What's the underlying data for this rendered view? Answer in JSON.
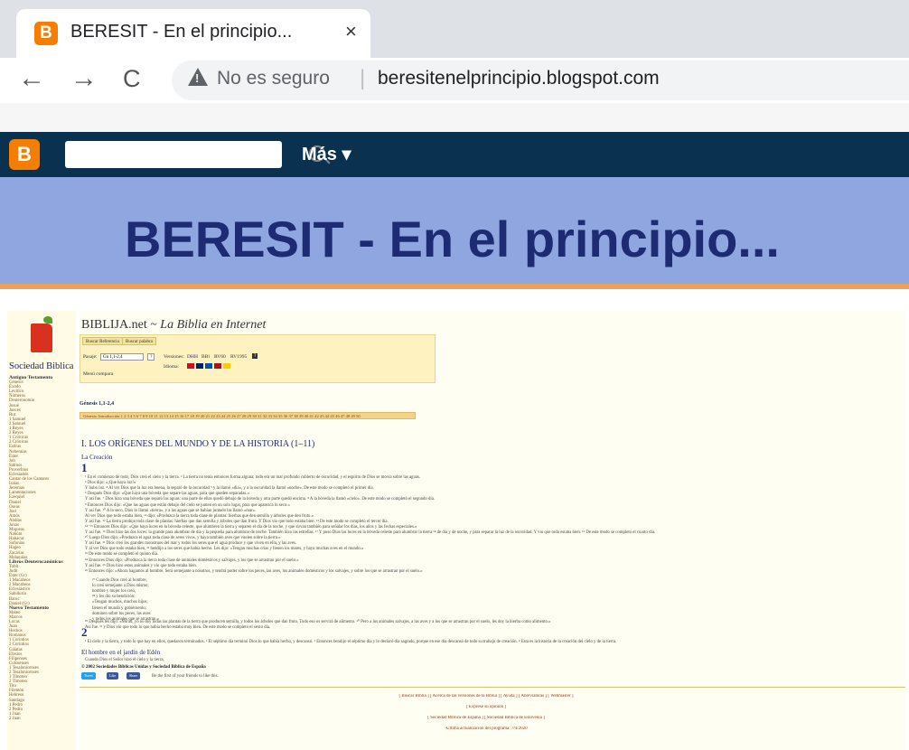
{
  "browser": {
    "tab_title": "BERESIT - En el principio...",
    "tab_close": "×",
    "tab_favicon_letter": "B",
    "nav_back": "←",
    "nav_forward": "→",
    "nav_reload": "C",
    "security_text": "No es seguro",
    "url": "beresitenelprincipio.blogspot.com"
  },
  "blogger_navbar": {
    "logo_letter": "B",
    "more_label": "Más ▾",
    "search_icon": "search-icon"
  },
  "blog": {
    "title": "BERESIT - En el principio..."
  },
  "embedded": {
    "sidebar": {
      "name": "Sociedad Biblica",
      "items": [
        {
          "text": "Antiguo Testamento",
          "heading": true
        },
        {
          "text": "Génesis"
        },
        {
          "text": "Éxodo"
        },
        {
          "text": "Levítico"
        },
        {
          "text": "Números"
        },
        {
          "text": "Deuteronomio"
        },
        {
          "text": "Josué"
        },
        {
          "text": "Jueces"
        },
        {
          "text": "Rut"
        },
        {
          "text": "1 Samuel"
        },
        {
          "text": "2 Samuel"
        },
        {
          "text": "1 Reyes"
        },
        {
          "text": "2 Reyes"
        },
        {
          "text": "1 Crónicas"
        },
        {
          "text": "2 Crónicas"
        },
        {
          "text": "Esdras"
        },
        {
          "text": "Nehemías"
        },
        {
          "text": "Ester"
        },
        {
          "text": "Job"
        },
        {
          "text": "Salmos"
        },
        {
          "text": "Proverbios"
        },
        {
          "text": "Eclesiastés"
        },
        {
          "text": "Cantar de los Cantares"
        },
        {
          "text": "Isaías"
        },
        {
          "text": "Jeremías"
        },
        {
          "text": "Lamentaciones"
        },
        {
          "text": "Ezequiel"
        },
        {
          "text": "Daniel"
        },
        {
          "text": "Oseas"
        },
        {
          "text": "Joel"
        },
        {
          "text": "Amós"
        },
        {
          "text": "Abdías"
        },
        {
          "text": "Jonás"
        },
        {
          "text": "Miqueas"
        },
        {
          "text": "Nahúm"
        },
        {
          "text": "Habacuc"
        },
        {
          "text": "Sofonías"
        },
        {
          "text": "Hageo"
        },
        {
          "text": "Zacarías"
        },
        {
          "text": "Malaquías"
        },
        {
          "text": "Libros Deuterocanónicos",
          "heading": true
        },
        {
          "text": "Tobit"
        },
        {
          "text": "Judit"
        },
        {
          "text": "Ester (Gr)"
        },
        {
          "text": "1 Macabeos"
        },
        {
          "text": "2 Macabeos"
        },
        {
          "text": "Eclesiástico"
        },
        {
          "text": "Sabiduría"
        },
        {
          "text": "Baruc"
        },
        {
          "text": "Daniel (Gr)"
        },
        {
          "text": "Nuevo Testamento",
          "heading": true
        },
        {
          "text": "Mateo"
        },
        {
          "text": "Marcos"
        },
        {
          "text": "Lucas"
        },
        {
          "text": "Juan"
        },
        {
          "text": "Hechos"
        },
        {
          "text": "Romanos"
        },
        {
          "text": "1 Corintios"
        },
        {
          "text": "2 Corintios"
        },
        {
          "text": "Gálatas"
        },
        {
          "text": "Efesios"
        },
        {
          "text": "Filipenses"
        },
        {
          "text": "Colosenses"
        },
        {
          "text": "1 Tesalonicenses"
        },
        {
          "text": "2 Tesalonicenses"
        },
        {
          "text": "1 Timoteo"
        },
        {
          "text": "2 Timoteo"
        },
        {
          "text": "Tito"
        },
        {
          "text": "Filemón"
        },
        {
          "text": "Hebreos"
        },
        {
          "text": "Santiago"
        },
        {
          "text": "1 Pedro"
        },
        {
          "text": "2 Pedro"
        },
        {
          "text": "1 Juan"
        },
        {
          "text": "2 Juan"
        }
      ]
    },
    "main": {
      "site": "BIBLIJA.net",
      "site_sep": "~",
      "site_subtitle": "La Biblia en Internet",
      "tabs": [
        "Buscar Referencia",
        "Buscar palabra"
      ],
      "passage_label": "Pasaje:",
      "passage_value": "Gn 1,1-2,4",
      "go_label": "?",
      "versions_label": "Versiones:",
      "versions": [
        "DHH",
        "BBl",
        "RV60",
        "RV1995",
        "?"
      ],
      "language_label": "Idioma:",
      "compare_label": "Menú compara",
      "reference": "Génesis 1,1-2,4",
      "chapter_bar": "Génesis:  Introducción 1 2 3 4 5 6 7 8 9 10 11 12 13 14 15 16 17 18 19 20 21 22 23 24 25 26 27 28 29 30 31 32 33 34 35 36 37 38 39 40 41 42 43 44 45 46 47 48 49 50",
      "section_title": "I. LOS ORÍGENES DEL MUNDO Y DE LA HISTORIA (1–11)",
      "subtitle": "La Creación",
      "chapter1": "1",
      "verses1": [
        "¹ En el comienzo de todo, Dios creó el cielo y la tierra. ² La tierra no tenía entonces forma alguna; todo era un mar profundo cubierto de oscuridad, y el espíritu de Dios se movía sobre las aguas.",
        "³ Dios dijo: «¡Que haya luz!»",
        "Y hubo luz. ⁴ Al ver Dios que la luz era buena, la separó de la oscuridad ⁵ y la llamó «día», y a la oscuridad la llamó «noche». De este modo se completó el primer día.",
        "⁶ Después Dios dijo: «Que haya una bóveda que separe las aguas, para que queden separadas.»",
        "Y así fue. ⁷ Dios hizo una bóveda que separó las aguas: una parte de ellas quedó debajo de la bóveda y otra parte quedó encima. ⁸ A la bóveda la llamó «cielo». De este modo se completó el segundo día.",
        "⁹ Entonces Dios dijo: «Que las aguas que están debajo del cielo se junten en un solo lugar, para que aparezca lo seco.»",
        "Y así fue. ¹⁰ A lo seco, Dios lo llamó «tierra», y a las aguas que se habían juntado las llamó «mar».",
        "Al ver Dios que todo estaba bien, ¹¹ dijo: «Produzca la tierra toda clase de plantas: hierbas que den semilla y árboles que den fruto.»",
        "Y así fue. ¹² La tierra produjo toda clase de plantas: hierbas que dan semilla y árboles que dan fruto. Y Dios vio que todo estaba bien. ¹³ De este modo se completó el tercer día.",
        "¹⁴⁻¹⁵ Entonces Dios dijo: «Que haya luces en la bóveda celeste, que alumbren la tierra y separen el día de la noche, y que sirvan también para señalar los días, los años y las fechas especiales.»",
        "Y así fue. ¹⁶ Dios hizo las dos luces: la grande para alumbrar de día y la pequeña para alumbrar de noche. También hizo las estrellas. ¹⁷ Y puso Dios las luces en la bóveda celeste para alumbrar la tierra ¹⁸ de día y de noche, y para separar la luz de la oscuridad. Y vio que todo estaba bien. ¹⁹ De este modo se completó el cuarto día.",
        "²⁰ Luego Dios dijo: «Produzca el agua toda clase de seres vivos, y haya también aves que vuelen sobre la tierra.»",
        "Y así fue. ²¹ Dios creó los grandes monstruos del mar y todos los seres que el agua produce y que viven en ella, y las aves.",
        "Y al ver Dios que todo estaba bien, ²² bendijo a los seres que había hecho. Les dijo: «Tengan muchas crías y llenen los mares, y haya muchas aves en el mundo.»",
        "²³ De este modo se completó el quinto día.",
        "²⁴ Entonces Dios dijo: «Produzca la tierra toda clase de animales domésticos y salvajes, y los que se arrastran por el suelo.»",
        "Y así fue. ²⁵ Dios hizo estos animales y vio que todo estaba bien.",
        "²⁶ Entonces dijo: «Ahora hagamos al hombre. Será semejante a nosotros, y tendrá poder sobre los peces, las aves, los animales domésticos y los salvajes, y sobre los que se arrastran por el suelo.»"
      ],
      "poem": [
        "²⁷ Cuando Dios creó al hombre,",
        "lo creó semejante a Dios mismo;",
        "hombre y mujer los creó,",
        "²⁸ y les dio su bendición:",
        "«Tengan muchos, muchos hijos;",
        "llenen el mundo y gobiérnenlo;",
        "dominen sobre los peces, las aves",
        "y todos los animales que se arrastran.»"
      ],
      "verses1_end": [
        "²⁹ Después les dijo: «Mirad, yo os doy todas las plantas de la tierra que producen semilla, y todos los árboles que dan fruto. Todo eso os servirá de alimento. ³⁰ Pero a los animales salvajes, a las aves y a los que se arrastran por el suelo, les doy la hierba como alimento.»",
        "Así fue. ³¹ y Dios vio que todo lo que había hecho estaba muy bien. De este modo se completó el sexto día."
      ],
      "chapter2": "2",
      "verses2": [
        "¹ El cielo y la tierra, y todo lo que hay en ellos, quedaron terminados. ² El séptimo día terminó Dios lo que había hecho, y descansó. ³ Entonces bendijo el séptimo día y lo declaró día sagrado, porque en ese día descansó de todo su trabajo de creación. ⁴ Esta es la historia de la creación del cielo y de la tierra."
      ],
      "subtitle2": "El hombre en el jardín de Edén",
      "verses2_end": "Cuando Dios el Señor hizo el cielo y la tierra,",
      "copyright": "© 2002 Sociedades Bíblicas Unidas y Sociedad Bíblica de España",
      "share": [
        "Tweet",
        "Like",
        "Share"
      ],
      "share_note": "Be the first of your friends to like this.",
      "footer": [
        "[ Buscar Biblia ] [ Acerca de las versiones de la Biblia ] [ Ayuda ] [ Abreviaturas ] [ Webmaster ]",
        "[ Exprese su opinión ]",
        "[ Sociedad Bíblica de España ] [ Sociedad Bíblica de Eslovenia ]",
        "-Ultima actualización del programa: 7/4/2020"
      ],
      "colors": {
        "accent_blue": "#1a2a8c",
        "panel": "#fdf2c0",
        "chapter_bar": "#f2d38c"
      }
    }
  }
}
